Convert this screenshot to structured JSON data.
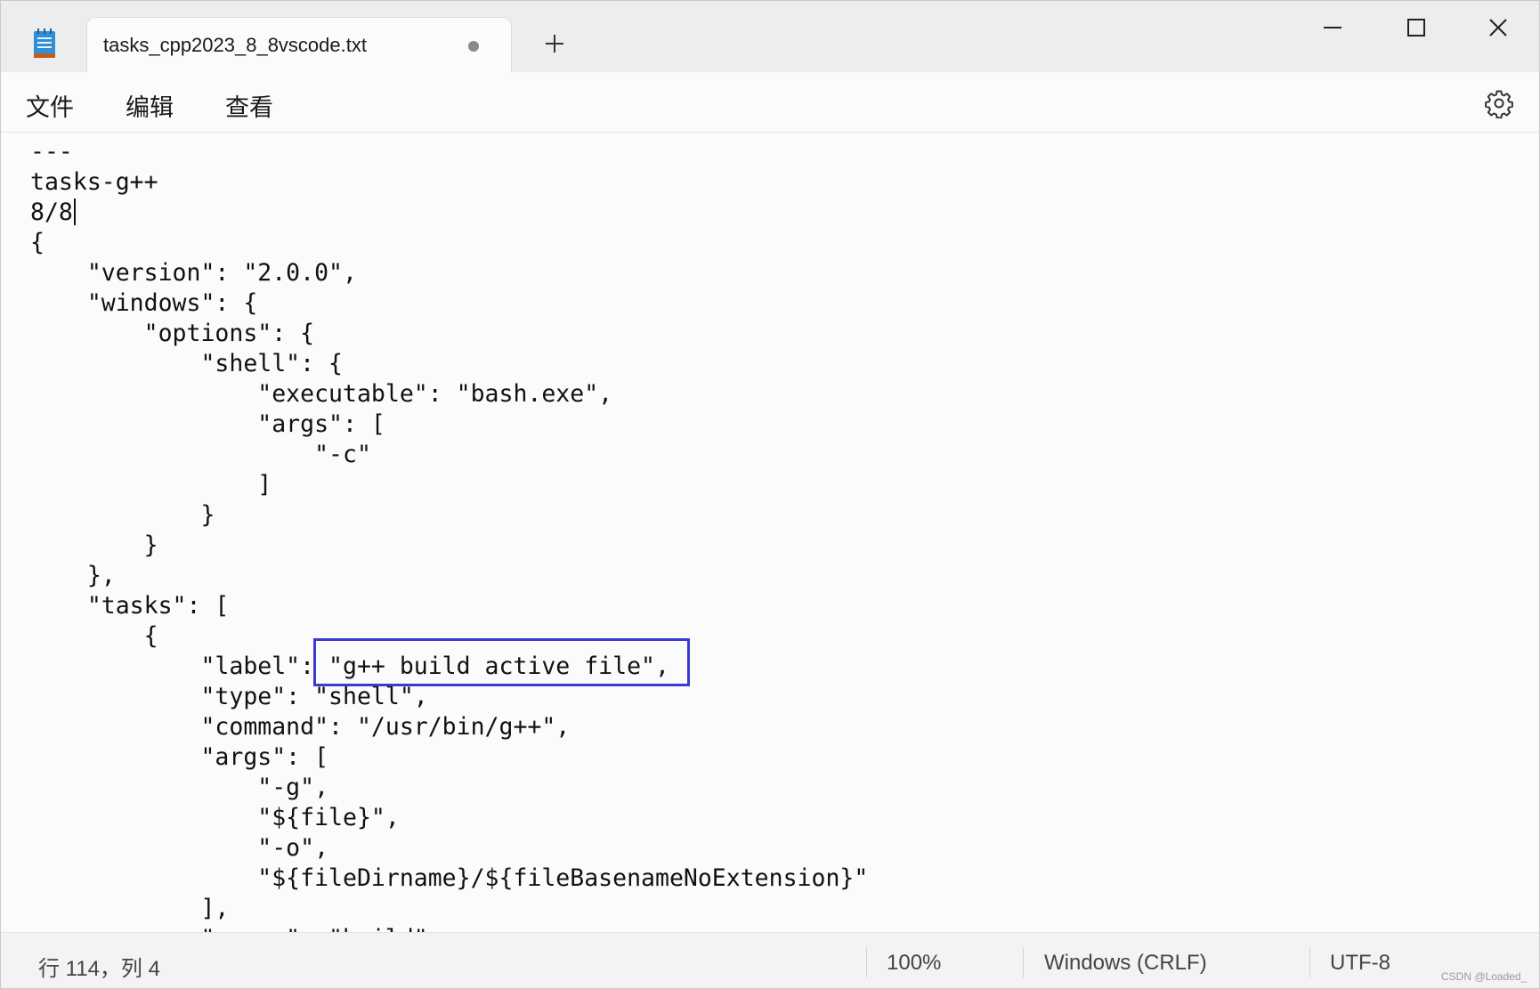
{
  "window": {
    "tab_title": "tasks_cpp2023_8_8vscode.txt",
    "unsaved_indicator": "unsaved-dot-icon",
    "icons": {
      "app": "notepad-icon",
      "new_tab": "plus-icon",
      "minimize": "minimize-icon",
      "maximize": "maximize-icon",
      "close": "close-icon"
    }
  },
  "menu": {
    "file": "文件",
    "edit": "编辑",
    "view": "查看",
    "settings_icon": "gear-icon"
  },
  "editor": {
    "lines": [
      "---",
      "tasks-g++",
      "8/8",
      "{",
      "    \"version\": \"2.0.0\",",
      "    \"windows\": {",
      "        \"options\": {",
      "            \"shell\": {",
      "                \"executable\": \"bash.exe\",",
      "                \"args\": [",
      "                    \"-c\"",
      "                ]",
      "            }",
      "        }",
      "    },",
      "    \"tasks\": [",
      "        {",
      "            \"label\": \"g++ build active file\",",
      "            \"type\": \"shell\",",
      "            \"command\": \"/usr/bin/g++\",",
      "            \"args\": [",
      "                \"-g\",",
      "                \"${file}\",",
      "                \"-o\",",
      "                \"${fileDirname}/${fileBasenameNoExtension}\"",
      "            ],",
      "            \"group\": \"build\""
    ],
    "highlight_color": "#3b3bcf"
  },
  "status": {
    "position": "行 114，列 4",
    "zoom": "100%",
    "line_ending": "Windows (CRLF)",
    "encoding": "UTF-8"
  },
  "watermark": "CSDN @Loaded_"
}
